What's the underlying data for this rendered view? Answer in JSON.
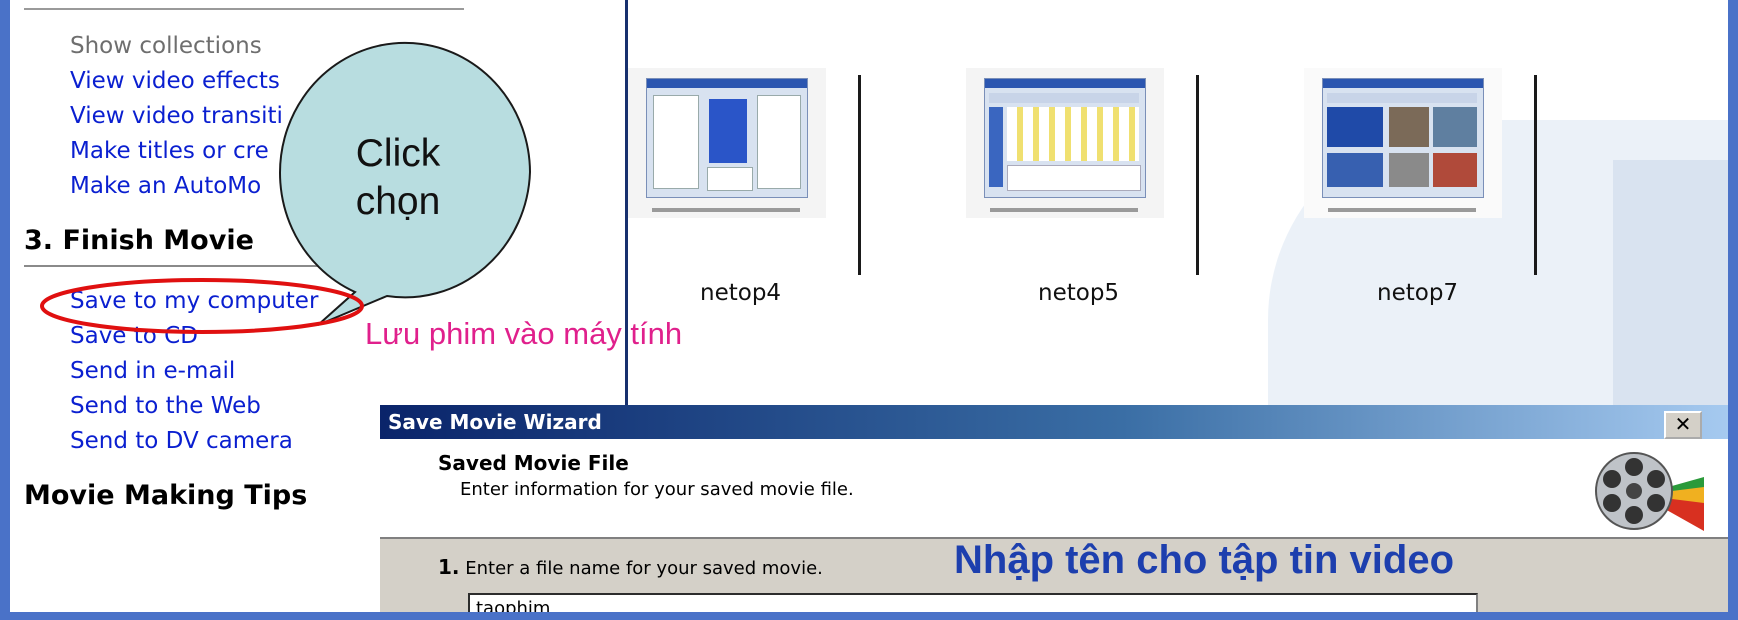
{
  "task_pane": {
    "top_links": [
      "Show collections",
      "View video effects",
      "View video transiti",
      "Make titles or cre",
      "Make an AutoMo"
    ],
    "finish_section": {
      "title": "3. Finish Movie",
      "links": [
        "Save to my computer",
        "Save to CD",
        "Send in e-mail",
        "Send to the Web",
        "Send to DV camera"
      ]
    },
    "tips_title": "Movie Making Tips"
  },
  "thumbnails": [
    {
      "label": "netop4"
    },
    {
      "label": "netop5"
    },
    {
      "label": "netop7"
    }
  ],
  "annotations": {
    "callout": [
      "Click",
      "chọn"
    ],
    "save_note": "Lưu phim vào máy tính",
    "filename_note": "Nhập tên cho tập tin video",
    "highlight_color": "#e01010",
    "arrow_color": "#e01010"
  },
  "dialog": {
    "title": "Save Movie Wizard",
    "close_label": "✕",
    "header_title": "Saved Movie File",
    "header_subtitle": "Enter information for your saved movie file.",
    "step_number": "1.",
    "step_label": "Enter a file name for your saved movie.",
    "file_name": "taophim"
  },
  "colors": {
    "link": "#0a1fd0",
    "title_bar": "#0a246a",
    "dialog_bg": "#d4d0c8",
    "slide_border": "#4a72c8"
  }
}
